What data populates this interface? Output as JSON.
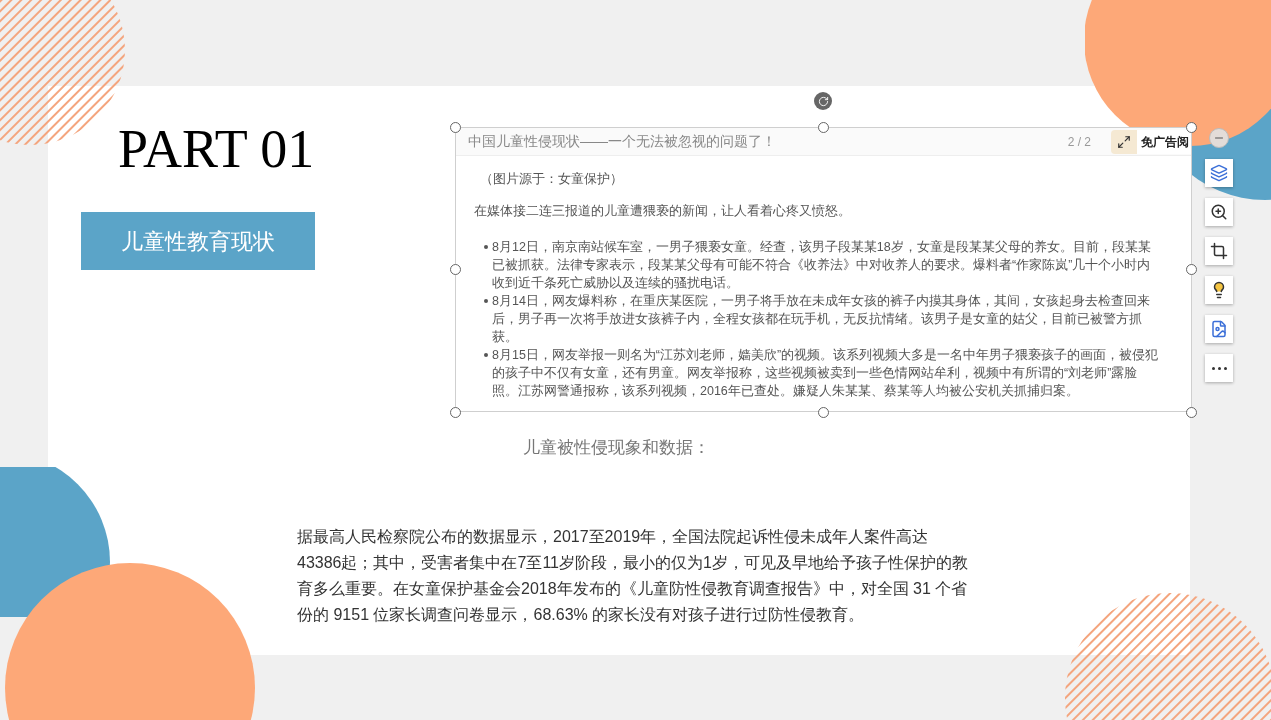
{
  "slide": {
    "title": "PART 01",
    "section_label": "儿童性教育现状",
    "embedded_page": {
      "header": "中国儿童性侵现状——一个无法被忽视的问题了！",
      "page_count": "2 / 2",
      "ad_free_button": "免广告阅",
      "source": "（图片源于：女童保护）",
      "intro": "在媒体接二连三报道的儿童遭猥亵的新闻，让人看着心疼又愤怒。",
      "bullets": [
        "8月12日，南京南站候车室，一男子猥亵女童。经查，该男子段某某18岁，女童是段某某父母的养女。目前，段某某已被抓获。法律专家表示，段某某父母有可能不符合《收养法》中对收养人的要求。爆料者“作家陈岚”几十个小时内收到近千条死亡威胁以及连续的骚扰电话。",
        "8月14日，网友爆料称，在重庆某医院，一男子将手放在未成年女孩的裤子内摸其身体，其间，女孩起身去检查回来后，男子再一次将手放进女孩裤子内，全程女孩都在玩手机，无反抗情绪。该男子是女童的姑父，目前已被警方抓获。",
        "8月15日，网友举报一则名为“江苏刘老师，嫱美欣”的视频。该系列视频大多是一名中年男子猥亵孩子的画面，被侵犯的孩子中不仅有女童，还有男童。网友举报称，这些视频被卖到一些色情网站牟利，视频中有所谓的“刘老师”露脸照。江苏网警通报称，该系列视频，2016年已查处。嫌疑人朱某某、蔡某等人均被公安机关抓捕归案。"
      ]
    },
    "caption": "儿童被性侵现象和数据：",
    "paragraph": "据最高人民检察院公布的数据显示，2017至2019年，全国法院起诉性侵未成年人案件高达43386起；其中，受害者集中在7至11岁阶段，最小的仅为1岁，可见及早地给予孩子性保护的教育多么重要。在女童保护基金会2018年发布的《儿童防性侵教育调查报告》中，对全国 31 个省份的 9151 位家长调查问卷显示，68.63% 的家长没有对孩子进行过防性侵教育。"
  },
  "toolbar": [
    {
      "kind": "collapse"
    },
    {
      "kind": "layers"
    },
    {
      "kind": "zoom"
    },
    {
      "kind": "crop"
    },
    {
      "kind": "idea"
    },
    {
      "kind": "convert"
    },
    {
      "kind": "more"
    }
  ]
}
